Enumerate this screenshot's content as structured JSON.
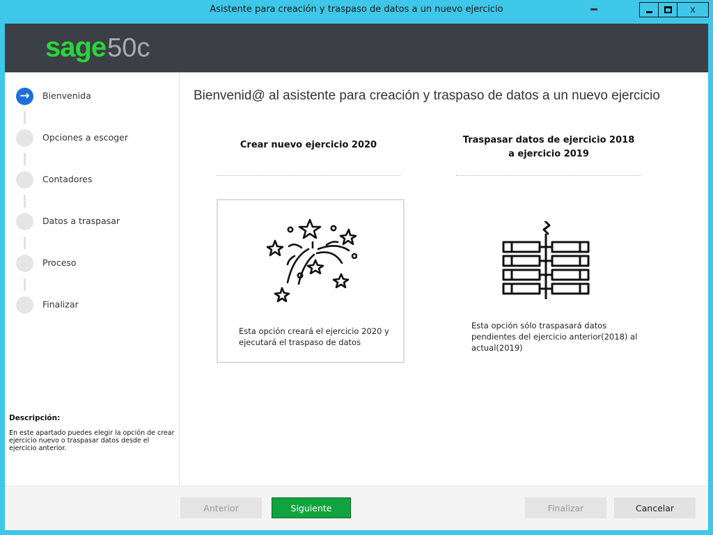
{
  "window": {
    "title": "Asistente para creación y traspaso de datos a un nuevo ejercicio",
    "close_glyph": "x"
  },
  "brand": {
    "name": "sage",
    "model": "50c",
    "color": "#2bd43a"
  },
  "steps": [
    {
      "label": "Bienvenida",
      "active": true,
      "icon": "arrow-right-icon"
    },
    {
      "label": "Opciones a escoger",
      "active": false
    },
    {
      "label": "Contadores",
      "active": false
    },
    {
      "label": "Datos a traspasar",
      "active": false
    },
    {
      "label": "Proceso",
      "active": false
    },
    {
      "label": "Finalizar",
      "active": false
    }
  ],
  "description": {
    "title": "Descripción:",
    "text": "En este apartado puedes elegir la opción de crear ejercicio nuevo o traspasar datos desde el ejercicio anterior."
  },
  "main": {
    "title": "Bienvenid@ al asistente para creación y traspaso de datos a un nuevo ejercicio",
    "options": [
      {
        "heading": "Crear nuevo ejercicio 2020",
        "text": "Esta opción creará el ejercicio 2020 y ejecutará el traspaso de datos",
        "icon": "fireworks-icon",
        "selected": true
      },
      {
        "heading_line1": "Traspasar datos de ejercicio 2018",
        "heading_line2": "a ejercicio 2019",
        "text": "Esta opción sólo traspasará datos pendientes del ejercicio anterior(2018) al actual(2019)",
        "icon": "data-transfer-icon",
        "selected": false
      }
    ]
  },
  "footer": {
    "prev_label": "Anterior",
    "next_label": "Siguiente",
    "finish_label": "Finalizar",
    "cancel_label": "Cancelar"
  },
  "colors": {
    "title_bar": "#3ec7e8",
    "header": "#3c3f45",
    "active_step": "#1f6fd8",
    "primary_button": "#11a33d"
  }
}
